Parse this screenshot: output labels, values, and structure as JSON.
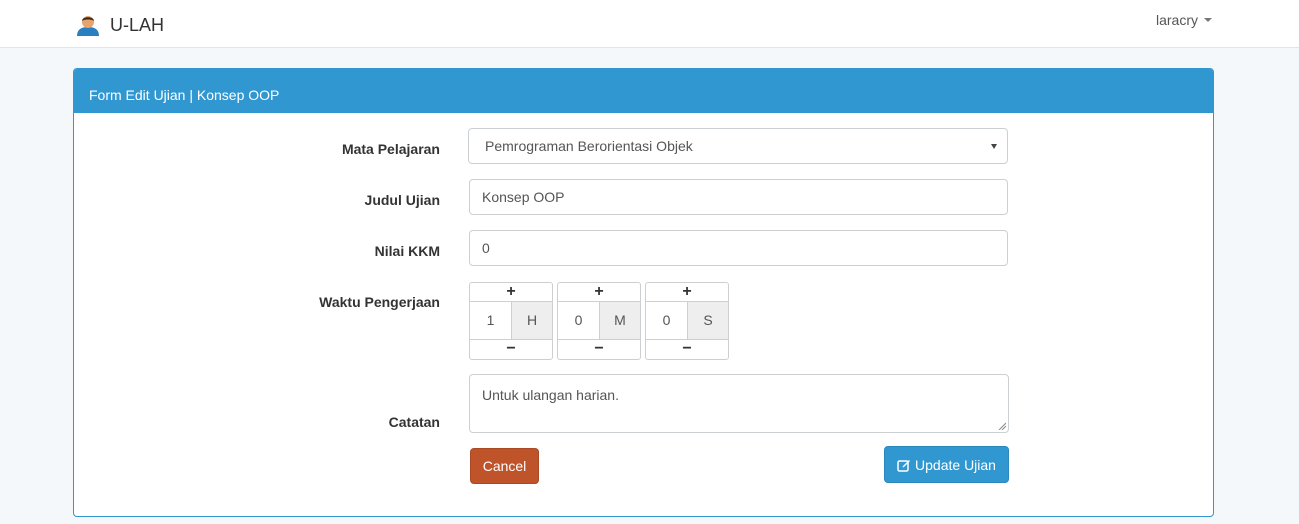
{
  "navbar": {
    "brand": "U-LAH",
    "user": "laracry"
  },
  "panel": {
    "title": "Form Edit Ujian | Konsep OOP"
  },
  "form": {
    "subject": {
      "label": "Mata Pelajaran",
      "value": "Pemrograman Berorientasi Objek"
    },
    "title": {
      "label": "Judul Ujian",
      "value": "Konsep OOP"
    },
    "kkm": {
      "label": "Nilai KKM",
      "value": "0"
    },
    "duration": {
      "label": "Waktu Pengerjaan",
      "hours": {
        "value": "1",
        "unit": "H"
      },
      "minutes": {
        "value": "0",
        "unit": "M"
      },
      "seconds": {
        "value": "0",
        "unit": "S"
      },
      "increment": "+",
      "decrement": "−"
    },
    "notes": {
      "label": "Catatan",
      "value": "Untuk ulangan harian."
    }
  },
  "actions": {
    "cancel": "Cancel",
    "update": "Update Ujian"
  },
  "colors": {
    "primary": "#3097d1",
    "danger": "#bf5329",
    "background": "#f5f8fa"
  },
  "icons": {
    "brand": "user-avatar-icon",
    "update": "edit-icon",
    "user_menu": "caret-down-icon"
  }
}
